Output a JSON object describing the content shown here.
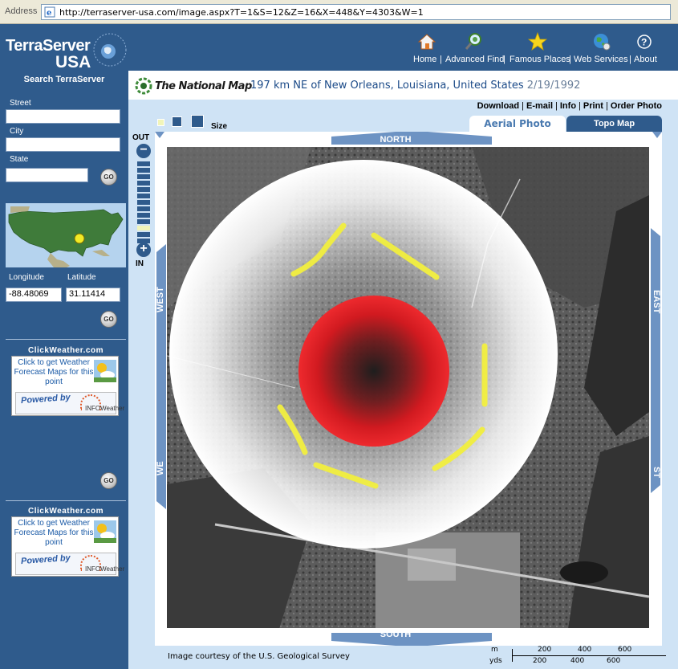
{
  "browser": {
    "address_label": "Address",
    "url": "http://terraserver-usa.com/image.aspx?T=1&S=12&Z=16&X=448&Y=4303&W=1"
  },
  "site": {
    "logo_line1": "TerraServer",
    "logo_line2": "USA"
  },
  "topnav": {
    "items": [
      {
        "label": "Home",
        "icon": "home-icon"
      },
      {
        "label": "Advanced Find",
        "icon": "find-icon"
      },
      {
        "label": "Famous Places",
        "icon": "star-icon"
      },
      {
        "label": "Web Services",
        "icon": "globe-icon"
      },
      {
        "label": "About",
        "icon": "help-icon"
      }
    ]
  },
  "sidebar": {
    "search_heading": "Search TerraServer",
    "street_label": "Street",
    "street_value": "",
    "city_label": "City",
    "city_value": "",
    "state_label": "State",
    "state_value": "",
    "go_label": "GO",
    "longitude_label": "Longitude",
    "latitude_label": "Latitude",
    "longitude_value": "-88.48069",
    "latitude_value": "31.11414",
    "weather_title": "ClickWeather.com",
    "weather_text": "Click to get Weather Forecast Maps for this point",
    "powered_by": "Powered by",
    "infoweather": "INFOWeather"
  },
  "header": {
    "national_map": "The National Map",
    "location": "197 km NE of New Orleans, Louisiana, United States",
    "date": "2/19/1992"
  },
  "actions": [
    "Download",
    "E-mail",
    "Info",
    "Print",
    "Order Photo"
  ],
  "size_label": "Size",
  "tabs": {
    "aerial": "Aerial Photo",
    "topo": "Topo Map"
  },
  "zoom": {
    "out_label": "OUT",
    "in_label": "IN",
    "steps": 13,
    "active_step": 10
  },
  "compass": {
    "north": "NORTH",
    "south": "SOUTH",
    "west": "WEST",
    "east": "EAST",
    "east_partial": "ST",
    "west_partial": "WE"
  },
  "footer": {
    "credit": "Image courtesy of the U.S. Geological Survey",
    "scale_m_label": "m",
    "scale_yds_label": "yds",
    "scale_m_ticks": [
      "200",
      "400",
      "600"
    ],
    "scale_yds_ticks": [
      "200",
      "400",
      "600"
    ]
  },
  "colors": {
    "navy": "#2f5b8c",
    "panel_light": "#cfe3f5",
    "highlight_red": "#e8141b",
    "highlight_yellow": "#f2ef3e"
  }
}
